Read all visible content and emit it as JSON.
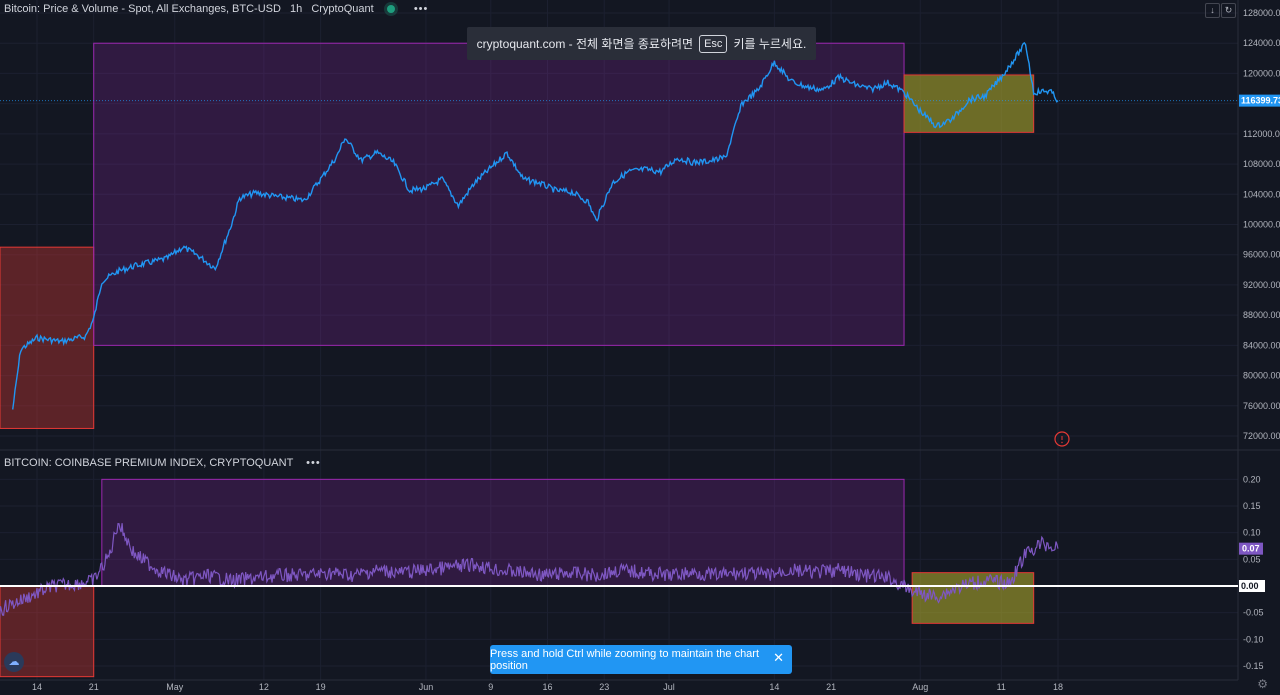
{
  "price_legend": {
    "title": "Bitcoin: Price & Volume - Spot, All Exchanges, BTC-USD",
    "interval": "1h",
    "source": "CryptoQuant",
    "more": "•••"
  },
  "premium_legend": {
    "title": "BITCOIN: COINBASE PREMIUM INDEX, CRYPTOQUANT",
    "more": "•••"
  },
  "toast": {
    "prefix": "cryptoquant.com - 전체 화면을 종료하려면",
    "key": "Esc",
    "suffix": "키를 누르세요."
  },
  "hint": {
    "text": "Press and hold Ctrl while zooming to maintain the chart position",
    "close": "✕"
  },
  "top_buttons": {
    "download": "↓",
    "refresh": "↻"
  },
  "logo": {
    "glyph": "☁"
  },
  "settings": {
    "glyph": "⚙"
  },
  "colors": {
    "background": "#131722",
    "price_line": "#2196f3",
    "premium_line": "#7e57c2",
    "purple_box": "#9c27b0",
    "red_box": "#e53935",
    "olive_box": "#b8b32b",
    "grid": "#1c2030",
    "axis_text": "#b2b5be",
    "zero_line": "#ffffff"
  },
  "chart_data": [
    {
      "type": "line",
      "title": "Bitcoin: Price & Volume - Spot, All Exchanges, BTC-USD",
      "series_name": "BTC-USD",
      "x_ticks": [
        "14",
        "21",
        "May",
        "12",
        "19",
        "Jun",
        "9",
        "16",
        "23",
        "Jul",
        "14",
        "21",
        "Aug",
        "11",
        "18"
      ],
      "y_ticks": [
        "128000.00",
        "124000.00",
        "120000.00",
        "116000.00",
        "112000.00",
        "108000.00",
        "104000.00",
        "100000.00",
        "96000.00",
        "92000.00",
        "88000.00",
        "84000.00",
        "80000.00",
        "76000.00",
        "72000.00"
      ],
      "ylim": [
        72000,
        128000
      ],
      "last_value_label": "116399.73",
      "last_value": 116399.73,
      "points": [
        [
          "Apr 11",
          75500
        ],
        [
          "Apr 12",
          83500
        ],
        [
          "Apr 13",
          84200
        ],
        [
          "Apr 14",
          85000
        ],
        [
          "Apr 17",
          84500
        ],
        [
          "Apr 20",
          85200
        ],
        [
          "Apr 21",
          87500
        ],
        [
          "Apr 22",
          92500
        ],
        [
          "Apr 24",
          93800
        ],
        [
          "Apr 26",
          94500
        ],
        [
          "Apr 28",
          95000
        ],
        [
          "Apr 30",
          95500
        ],
        [
          "May 2",
          97000
        ],
        [
          "May 4",
          95800
        ],
        [
          "May 6",
          94200
        ],
        [
          "May 8",
          100000
        ],
        [
          "May 9",
          103500
        ],
        [
          "May 11",
          104200
        ],
        [
          "May 13",
          103800
        ],
        [
          "May 15",
          103500
        ],
        [
          "May 17",
          103200
        ],
        [
          "May 19",
          106000
        ],
        [
          "May 21",
          109000
        ],
        [
          "May 22",
          111500
        ],
        [
          "May 24",
          108500
        ],
        [
          "May 26",
          109500
        ],
        [
          "May 28",
          108200
        ],
        [
          "May 30",
          104500
        ],
        [
          "Jun 1",
          104800
        ],
        [
          "Jun 3",
          106000
        ],
        [
          "Jun 5",
          102500
        ],
        [
          "Jun 7",
          105500
        ],
        [
          "Jun 9",
          107500
        ],
        [
          "Jun 11",
          109500
        ],
        [
          "Jun 13",
          106000
        ],
        [
          "Jun 15",
          105500
        ],
        [
          "Jun 17",
          104500
        ],
        [
          "Jun 19",
          104300
        ],
        [
          "Jun 21",
          103000
        ],
        [
          "Jun 22",
          100500
        ],
        [
          "Jun 24",
          105500
        ],
        [
          "Jun 26",
          107000
        ],
        [
          "Jun 28",
          107300
        ],
        [
          "Jun 30",
          107000
        ],
        [
          "Jul 2",
          108800
        ],
        [
          "Jul 4",
          108200
        ],
        [
          "Jul 6",
          108400
        ],
        [
          "Jul 8",
          108900
        ],
        [
          "Jul 10",
          116000
        ],
        [
          "Jul 12",
          117800
        ],
        [
          "Jul 14",
          121500
        ],
        [
          "Jul 16",
          119000
        ],
        [
          "Jul 18",
          118200
        ],
        [
          "Jul 20",
          117800
        ],
        [
          "Jul 22",
          119500
        ],
        [
          "Jul 24",
          118500
        ],
        [
          "Jul 26",
          117900
        ],
        [
          "Jul 28",
          118800
        ],
        [
          "Jul 30",
          117500
        ],
        [
          "Aug 1",
          115000
        ],
        [
          "Aug 3",
          113000
        ],
        [
          "Aug 5",
          114000
        ],
        [
          "Aug 7",
          116500
        ],
        [
          "Aug 9",
          117000
        ],
        [
          "Aug 11",
          119500
        ],
        [
          "Aug 13",
          122500
        ],
        [
          "Aug 14",
          124000
        ],
        [
          "Aug 15",
          117500
        ],
        [
          "Aug 17",
          117700
        ],
        [
          "Aug 18",
          116400
        ]
      ],
      "boxes": [
        {
          "color": "red",
          "x_start": "Apr 7",
          "x_end": "Apr 21",
          "y_low": 73000,
          "y_high": 97000
        },
        {
          "color": "purple",
          "x_start": "Apr 21",
          "x_end": "Jul 30",
          "y_low": 84000,
          "y_high": 124000
        },
        {
          "color": "olive",
          "x_start": "Jul 30",
          "x_end": "Aug 15",
          "y_low": 112200,
          "y_high": 119800
        }
      ]
    },
    {
      "type": "line",
      "title": "BITCOIN: COINBASE PREMIUM INDEX, CRYPTOQUANT",
      "series_name": "Coinbase Premium Index",
      "y_ticks": [
        "0.20",
        "0.15",
        "0.10",
        "0.05",
        "0.00",
        "-0.05",
        "-0.10",
        "-0.15"
      ],
      "ylim": [
        -0.17,
        0.22
      ],
      "last_value_label": "0.07",
      "last_value": 0.07,
      "zero_label": "0.00",
      "points": [
        [
          "Apr 7",
          -0.09
        ],
        [
          "Apr 10",
          -0.04
        ],
        [
          "Apr 13",
          -0.02
        ],
        [
          "Apr 16",
          0.0
        ],
        [
          "Apr 19",
          0.005
        ],
        [
          "Apr 21",
          0.01
        ],
        [
          "Apr 23",
          0.06
        ],
        [
          "Apr 24",
          0.12
        ],
        [
          "Apr 26",
          0.06
        ],
        [
          "Apr 29",
          0.03
        ],
        [
          "May 2",
          0.01
        ],
        [
          "May 5",
          0.02
        ],
        [
          "May 8",
          0.01
        ],
        [
          "May 11",
          0.015
        ],
        [
          "May 14",
          0.02
        ],
        [
          "May 17",
          0.02
        ],
        [
          "May 20",
          0.025
        ],
        [
          "May 23",
          0.02
        ],
        [
          "May 26",
          0.03
        ],
        [
          "May 29",
          0.025
        ],
        [
          "Jun 1",
          0.03
        ],
        [
          "Jun 4",
          0.035
        ],
        [
          "Jun 7",
          0.04
        ],
        [
          "Jun 10",
          0.03
        ],
        [
          "Jun 13",
          0.025
        ],
        [
          "Jun 16",
          0.02
        ],
        [
          "Jun 19",
          0.025
        ],
        [
          "Jun 22",
          0.02
        ],
        [
          "Jun 25",
          0.03
        ],
        [
          "Jun 28",
          0.025
        ],
        [
          "Jul 1",
          0.02
        ],
        [
          "Jul 4",
          0.025
        ],
        [
          "Jul 7",
          0.02
        ],
        [
          "Jul 10",
          0.025
        ],
        [
          "Jul 13",
          0.02
        ],
        [
          "Jul 16",
          0.03
        ],
        [
          "Jul 19",
          0.025
        ],
        [
          "Jul 22",
          0.03
        ],
        [
          "Jul 25",
          0.02
        ],
        [
          "Jul 28",
          0.015
        ],
        [
          "Jul 31",
          -0.01
        ],
        [
          "Aug 3",
          -0.02
        ],
        [
          "Aug 6",
          0.0
        ],
        [
          "Aug 9",
          0.01
        ],
        [
          "Aug 12",
          0.005
        ],
        [
          "Aug 14",
          0.06
        ],
        [
          "Aug 16",
          0.08
        ],
        [
          "Aug 18",
          0.07
        ]
      ],
      "boxes": [
        {
          "color": "red",
          "x_start": "Apr 7",
          "x_end": "Apr 21",
          "y_low": -0.17,
          "y_high": 0.0
        },
        {
          "color": "purple",
          "x_start": "Apr 22",
          "x_end": "Jul 30",
          "y_low": 0.0,
          "y_high": 0.2
        },
        {
          "color": "olive",
          "x_start": "Jul 31",
          "x_end": "Aug 15",
          "y_low": -0.07,
          "y_high": 0.025
        }
      ]
    }
  ]
}
